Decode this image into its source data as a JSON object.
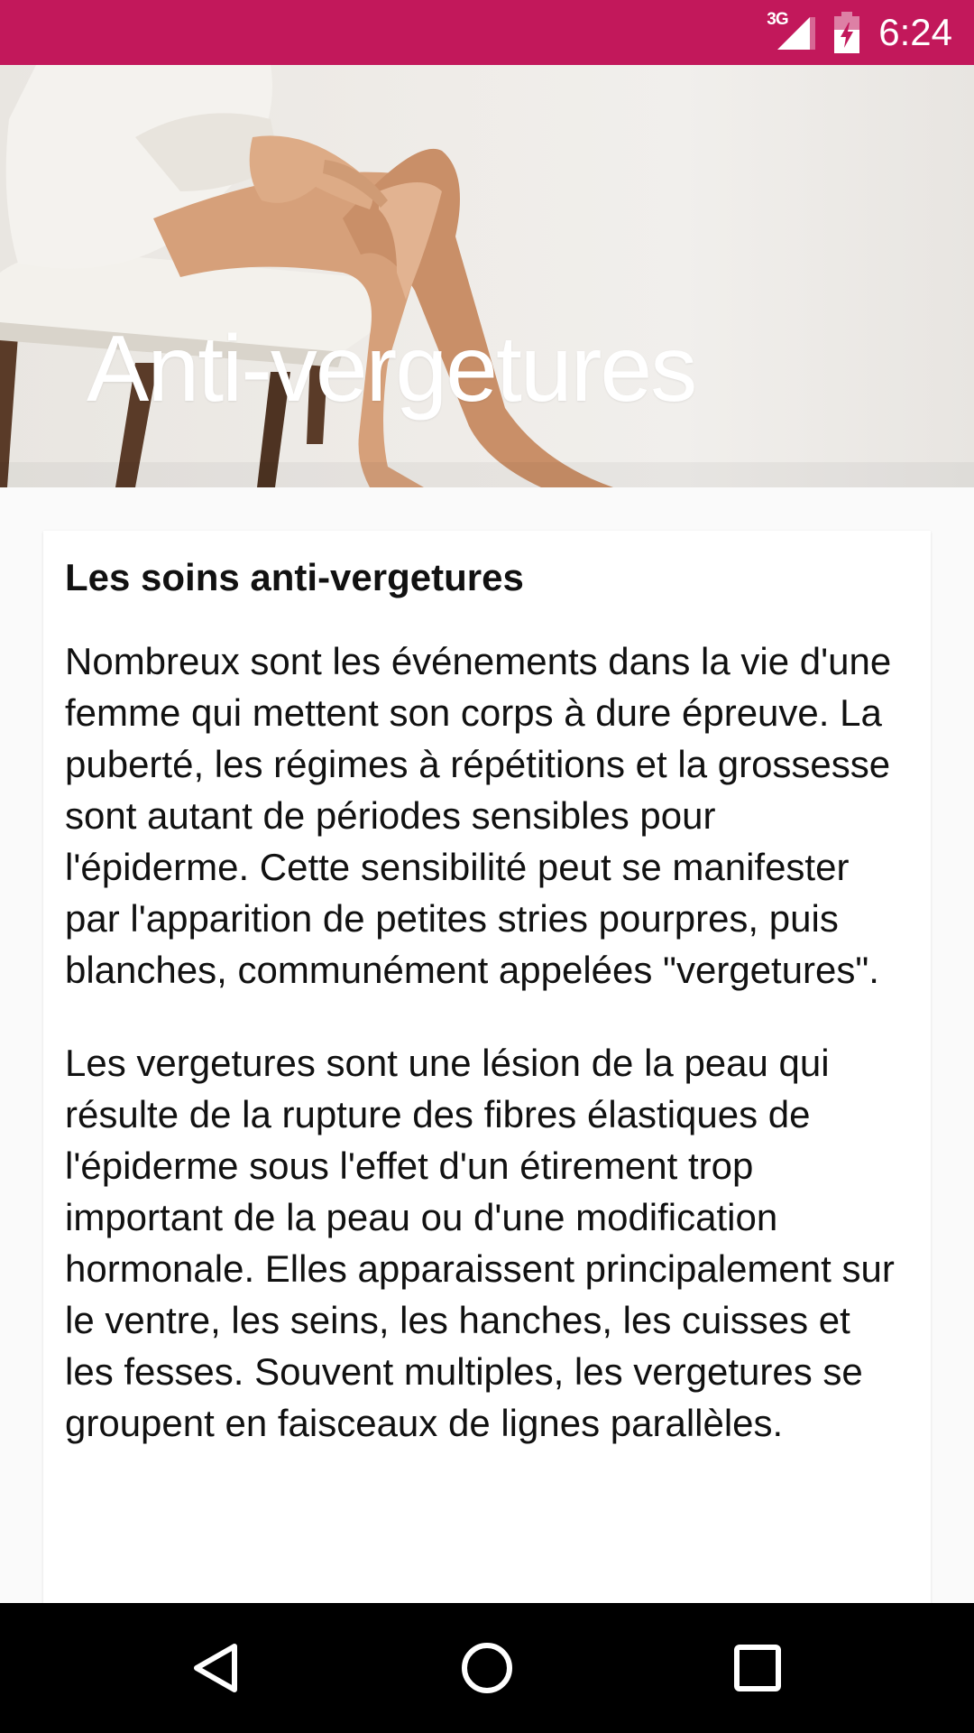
{
  "status_bar": {
    "network_label": "3G",
    "time": "6:24",
    "background": "#c2185b"
  },
  "header": {
    "title": "Anti-vergetures"
  },
  "article": {
    "heading": "Les soins anti-vergetures",
    "paragraphs": [
      "Nombreux sont les événements dans la vie d'une femme qui mettent son corps à dure épreuve. La puberté, les régimes à répétitions et la grossesse sont autant de périodes sensibles pour l'épiderme. Cette sensibilité peut se manifester par l'apparition de petites stries pourpres, puis blanches, communément appelées \"vergetures\".",
      "Les vergetures sont une lésion de la peau qui résulte de la rupture des fibres élastiques de l'épiderme sous l'effet d'un étirement trop important de la peau ou d'une modification hormonale. Elles apparaissent principalement sur le ventre, les seins, les hanches, les cuisses et les fesses. Souvent multiples, les vergetures se groupent en faisceaux de lignes parallèles."
    ]
  },
  "nav_bar": {
    "icons": [
      "back-icon",
      "home-icon",
      "recents-icon"
    ]
  }
}
